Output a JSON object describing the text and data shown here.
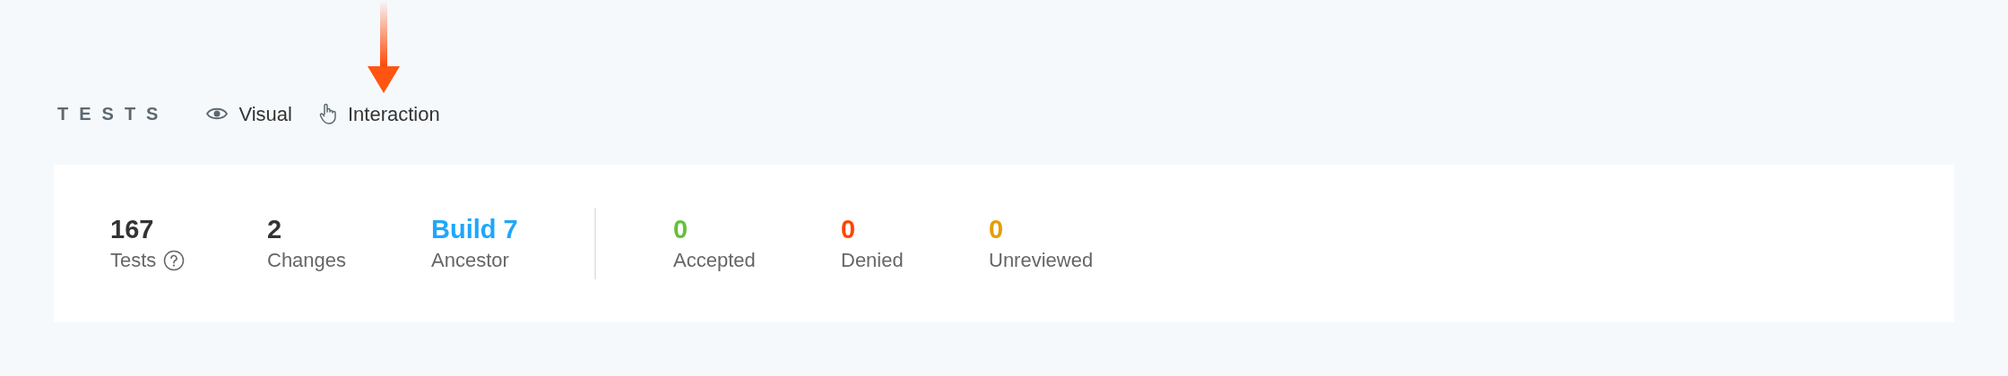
{
  "section": {
    "title": "TESTS",
    "modes": [
      {
        "label": "Visual",
        "kind": "eye"
      },
      {
        "label": "Interaction",
        "kind": "hand"
      }
    ]
  },
  "summary": [
    {
      "value": "167",
      "label": "Tests",
      "kind": "help",
      "color": "#333333"
    },
    {
      "value": "2",
      "label": "Changes",
      "color": "#333333"
    },
    {
      "value": "Build 7",
      "label": "Ancestor",
      "kind": "link",
      "color": "#1ea7fd"
    }
  ],
  "review": [
    {
      "value": "0",
      "label": "Accepted",
      "color": "#66bf3c"
    },
    {
      "value": "0",
      "label": "Denied",
      "color": "#ff4400"
    },
    {
      "value": "0",
      "label": "Unreviewed",
      "color": "#e69d00"
    }
  ]
}
